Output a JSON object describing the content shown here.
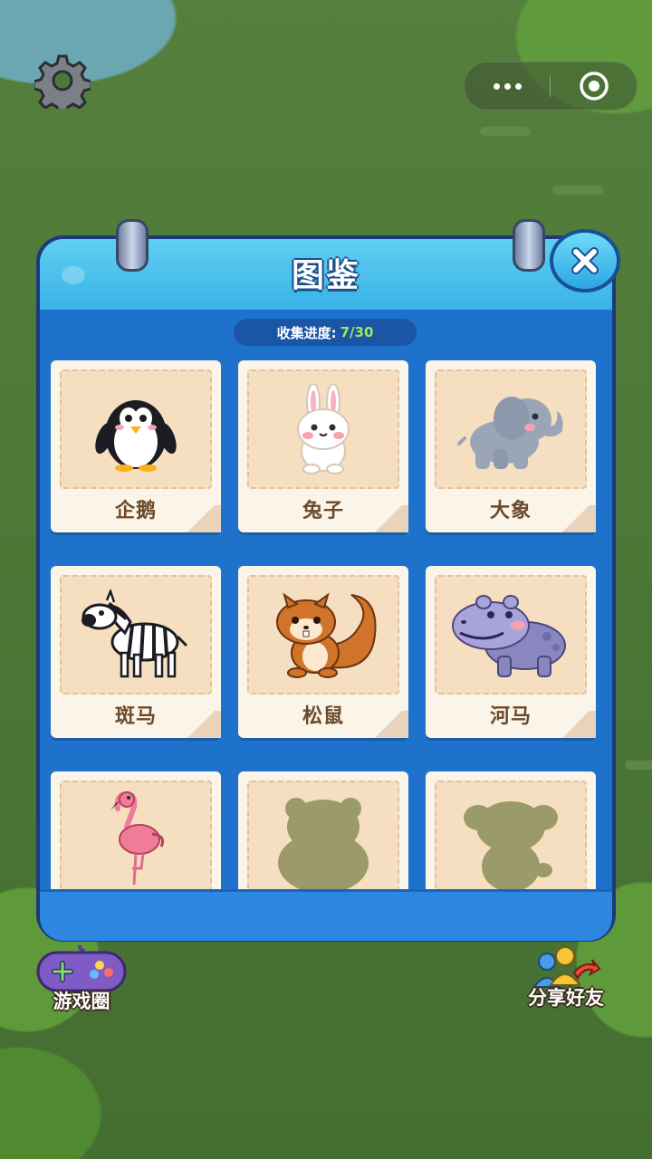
{
  "panel": {
    "title": "图鉴",
    "progress_label": "收集进度:",
    "progress_value": "7/30",
    "progress": {
      "collected": 7,
      "total": 30
    }
  },
  "animals": [
    {
      "name": "企鹅",
      "icon": "penguin-icon",
      "unlocked": true
    },
    {
      "name": "兔子",
      "icon": "rabbit-icon",
      "unlocked": true
    },
    {
      "name": "大象",
      "icon": "elephant-icon",
      "unlocked": true
    },
    {
      "name": "斑马",
      "icon": "zebra-icon",
      "unlocked": true
    },
    {
      "name": "松鼠",
      "icon": "squirrel-icon",
      "unlocked": true
    },
    {
      "name": "河马",
      "icon": "hippo-icon",
      "unlocked": true
    },
    {
      "name": "",
      "icon": "flamingo-icon",
      "unlocked": true
    },
    {
      "name": "",
      "icon": "bear-silhouette-icon",
      "unlocked": false
    },
    {
      "name": "",
      "icon": "dog-silhouette-icon",
      "unlocked": false
    }
  ],
  "bottom": {
    "game_circle": "游戏圈",
    "share": "分享好友"
  },
  "icons": {
    "settings": "gear-icon",
    "close": "close-icon",
    "more": "more-dots-icon",
    "target": "target-icon"
  },
  "colors": {
    "panel_blue": "#1e72cc",
    "header_cyan": "#3ab2e8",
    "progress_green": "#9eea52",
    "card_bg": "#fbf4e8",
    "locked_silhouette": "#9a9a6a"
  }
}
